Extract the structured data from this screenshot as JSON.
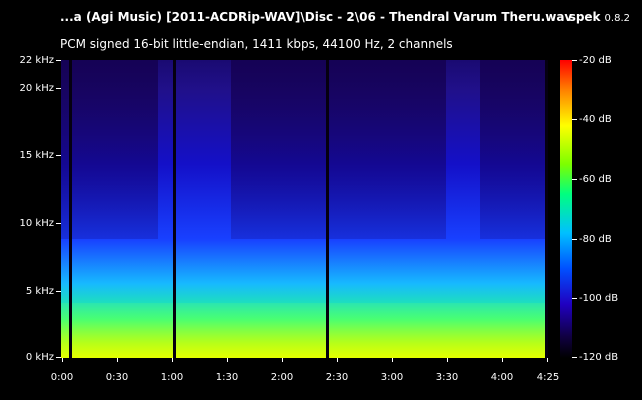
{
  "header": {
    "title": "...a (Agi Music) [2011-ACDRip-WAV]\\Disc - 2\\06 - Thendral Varum Theru.wav",
    "app_name": "spek",
    "app_version": "0.8.2",
    "subtitle": "PCM signed 16-bit little-endian, 1411 kbps, 44100 Hz, 2 channels"
  },
  "y_axis": {
    "labels": [
      "22 kHz",
      "20 kHz",
      "15 kHz",
      "10 kHz",
      "5 kHz",
      "0 kHz"
    ]
  },
  "x_axis": {
    "labels": [
      "0:00",
      "0:30",
      "1:00",
      "1:30",
      "2:00",
      "2:30",
      "3:00",
      "3:30",
      "4:00",
      "4:25"
    ]
  },
  "color_scale": {
    "labels": [
      "-20 dB",
      "-40 dB",
      "-60 dB",
      "-80 dB",
      "-100 dB",
      "-120 dB"
    ]
  }
}
